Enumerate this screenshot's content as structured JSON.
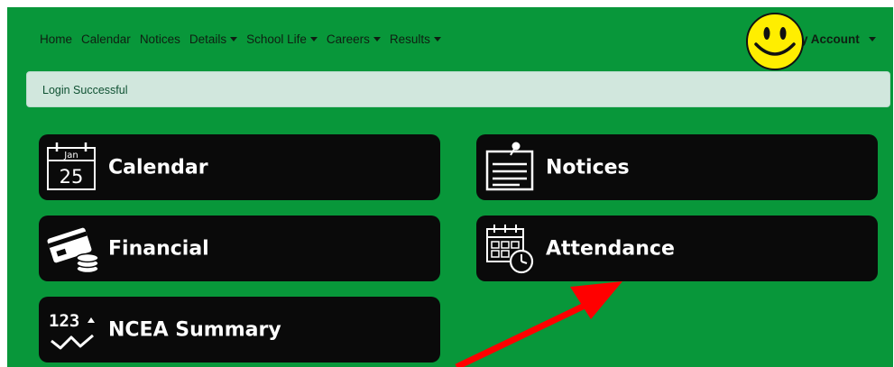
{
  "nav": {
    "items": [
      {
        "label": "Home",
        "dropdown": false
      },
      {
        "label": "Calendar",
        "dropdown": false
      },
      {
        "label": "Notices",
        "dropdown": false
      },
      {
        "label": "Details",
        "dropdown": true
      },
      {
        "label": "School Life",
        "dropdown": true
      },
      {
        "label": "Careers",
        "dropdown": true
      },
      {
        "label": "Results",
        "dropdown": true
      }
    ],
    "account_label": "y Account"
  },
  "alert": {
    "message": "Login Successful"
  },
  "tiles": {
    "calendar": {
      "label": "Calendar",
      "icon": "calendar-icon",
      "icon_month": "Jan",
      "icon_day": "25"
    },
    "notices": {
      "label": "Notices",
      "icon": "notice-board-icon"
    },
    "financial": {
      "label": "Financial",
      "icon": "card-coins-icon"
    },
    "attendance": {
      "label": "Attendance",
      "icon": "calendar-clock-icon"
    },
    "ncea": {
      "label": "NCEA Summary",
      "icon": "123-chart-icon",
      "icon_text": "123"
    }
  },
  "colors": {
    "background": "#08973a",
    "tile": "#0a0a0a",
    "alert_bg": "#d1e7dd",
    "alert_text": "#0f5132",
    "annotation_arrow": "#ff0000",
    "smiley": "#ffee00"
  }
}
